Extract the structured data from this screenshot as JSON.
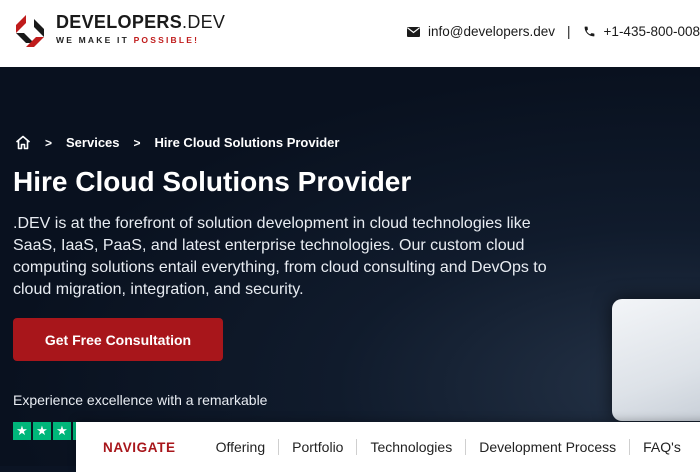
{
  "header": {
    "brand_name_bold": "DEVELOPERS",
    "brand_name_thin": ".DEV",
    "tagline_main": "WE MAKE IT ",
    "tagline_accent": "POSSIBLE!",
    "email": "info@developers.dev",
    "separator": "|",
    "phone": "+1-435-800-008",
    "icons": [
      "developers-dev-logo",
      "mail-icon",
      "phone-icon"
    ]
  },
  "breadcrumb": {
    "home_icon": "home-icon",
    "items": [
      "Services",
      "Hire Cloud Solutions Provider"
    ],
    "separator": ">"
  },
  "hero": {
    "title": "Hire Cloud Solutions Provider",
    "description": ".DEV is at the forefront of solution development in cloud technologies like SaaS, IaaS, PaaS, and latest enterprise technologies. Our custom cloud computing solutions entail everything, from cloud consulting and DevOps to cloud migration, integration, and security.",
    "cta_label": "Get Free Consultation",
    "excellence_text": "Experience excellence with a remarkable",
    "rating_icon": "trustpilot-star-icon"
  },
  "navbar": {
    "label": "NAVIGATE",
    "items": [
      "Offering",
      "Portfolio",
      "Technologies",
      "Development Process",
      "FAQ's"
    ]
  },
  "colors": {
    "accent": "#a8161b",
    "hero_bg": "#0b1424",
    "trustpilot": "#00b67a"
  }
}
